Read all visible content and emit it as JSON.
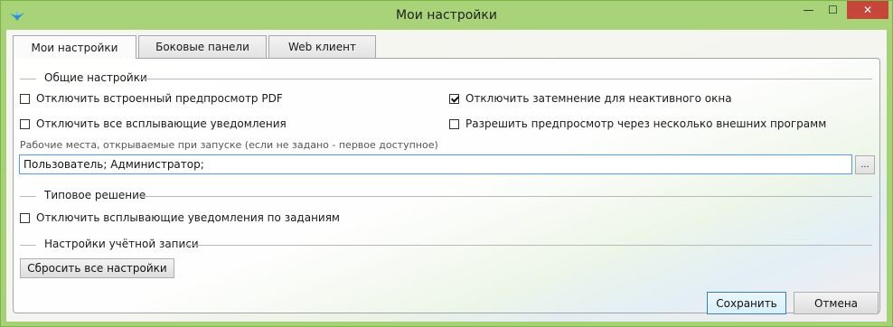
{
  "window": {
    "title": "Мои настройки",
    "minimize_symbol": "—",
    "maximize_symbol": "☐",
    "close_symbol": "✕",
    "accent_color": "#a9d378"
  },
  "tabs": [
    {
      "label": "Мои настройки",
      "active": true
    },
    {
      "label": "Боковые панели",
      "active": false
    },
    {
      "label": "Web клиент",
      "active": false
    }
  ],
  "general": {
    "title": "Общие настройки",
    "disable_pdf_preview": {
      "label": "Отключить встроенный предпросмотр PDF",
      "checked": false
    },
    "disable_dimming": {
      "label": "Отключить затемнение для неактивного окна",
      "checked": true
    },
    "disable_popups": {
      "label": "Отключить все всплывающие уведомления",
      "checked": false
    },
    "allow_multi_preview": {
      "label": "Разрешить предпросмотр через несколько внешних программ",
      "checked": false
    },
    "workplaces_label": "Рабочие места, открываемые при запуске (если не задано - первое доступное)",
    "workplaces_value": "Пользователь; Администратор;",
    "browse_label": "..."
  },
  "typical": {
    "title": "Типовое решение",
    "disable_task_popups": {
      "label": "Отключить всплывающие уведомления по заданиям",
      "checked": false
    }
  },
  "account": {
    "title": "Настройки учётной записи",
    "reset_label": "Сбросить все настройки"
  },
  "footer": {
    "save_label": "Сохранить",
    "cancel_label": "Отмена"
  }
}
